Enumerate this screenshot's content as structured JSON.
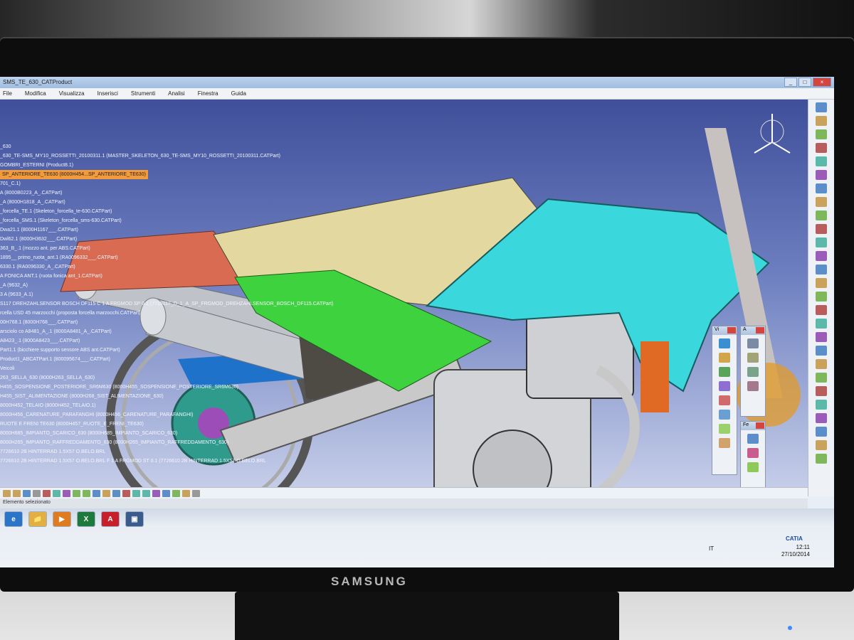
{
  "monitor": {
    "brand": "SAMSUNG"
  },
  "window": {
    "title": "SMS_TE_630_CATProduct",
    "controls": [
      "_",
      "□",
      "×"
    ]
  },
  "menubar": {
    "items": [
      "File",
      "Modifica",
      "Visualizza",
      "Inserisci",
      "Strumenti",
      "Analisi",
      "Finestra",
      "Guida"
    ]
  },
  "tree": {
    "items": [
      "_630",
      "_630_TE-SMS_MY10_ROSSETTI_20100311.1 (MASTER_SKELETON_630_TE-SMS_MY10_ROSSETTI_20100311.CATPart)",
      "GOMBRI_ESTERNI (Product8.1)",
      "SP_ANTERIORE_TE630 (8000H454...SP_ANTERIORE_TE630)",
      "701_C.1)",
      "A (8000B0223_A_.CATPart)",
      "_A (8000H1818_A_.CATPart)",
      "_forcella_TE.1 (Skeleton_forcella_te-630.CATPart)",
      "_forcella_SMS.1 (Skeleton_forcella_sms-630.CATPart)",
      "Dwa21.1 (8000H1167___.CATPart)",
      "Dwl62.1 (8000H3632___.CATPart)",
      "363_B_.1 (mozzo ant. per ABS.CATPart)",
      "1895__ primo_ruota_ant.1 (RA0096332___.CATPart)",
      "6330.1 (RA0096330_A_.CATPart)",
      "A FONICA ANT.1 (ruota fonica ant_1.CATPart)",
      "_A (9632_A)",
      "3 A (9633_A.1)",
      "S117 DREHZAHLSENSOR BOSCH DF115",
      "rcella USD 45 marzocchi (proposta forcella marzocchi.CATPart)",
      "00H768.1 (8000H768___.CATPart)",
      "arsciolo co A8481_A_.1 (8000A8481_A_.CATPart)",
      "A8423_.1 (8000A8423___.CATPart)",
      "Part1.1 (bicchiere supporto sensore ABS ant.CATPart)",
      "Product1_ABCATPart.1 (800095674___.CATPart)",
      "Veicoli",
      "263_SELLA_630 (8000H263_SELLA_630)",
      "H455_SOSPENSIONE_POSTERIORE_SR6M630 (8000H455_SOSPENSIONE_POSTERIORE_SR6M630)",
      "H455_SIST_ALIMENTAZIONE (8000H268_SIST_ALIMENTAZIONE_630)",
      "8000H452_TELAIO (8000H452_TELAIO.1)",
      "8000H456_CARENATURE_PARAFANGHI (8000H456_CARENATURE_PARAFANGHI)",
      "RUOTE E FRENI TE630 (8000H457_RUOTE_E_FRENI_TE630)",
      "8000H685_IMPIANTO_SCARICO_630 (8000H685_IMPIANTO_SCARICO_630)",
      "8000H265_IMPIANTO_RAFFREDDAMENTO_630 (8000H265_IMPIANTO_RAFFREDDAMENTO_630)",
      "7726610 2B HINTERRAD 1.5X57 O.BELO.BRL",
      "7726610 2B HINTERRAD 1.5X57 O.BELO.BRL"
    ],
    "selected_index": 3,
    "callout": "C 1 A FRGMOD SP 0.1 (7715117_D_1_A_SP_FRGMOD_DREHZAHLSENSOR_BOSCH_DF115.CATPart)",
    "callout2": "F 1 A FRGMOD ST 0.1 (7726610 2B HINTERRAD 1.5X57 O.BELO.BRL"
  },
  "panels": [
    {
      "title": "Vi"
    },
    {
      "title": "A"
    },
    {
      "title": "Fe"
    }
  ],
  "status": {
    "text": "Elemento selezionato"
  },
  "taskbar": {
    "apps": [
      "e",
      "📁",
      "▶",
      "X",
      "A",
      "▣"
    ],
    "language": "IT",
    "time": "12:11",
    "date": "27/10/2014"
  },
  "logo": {
    "text": "CATIA"
  },
  "colors": {
    "viewport_top": "#3f4f9a",
    "seat": "#e3d9a0",
    "tail": "#d96b53",
    "side_panel": "#3fd23f",
    "tank_cover": "#3ad7dd",
    "selection": "#f39a3b"
  }
}
